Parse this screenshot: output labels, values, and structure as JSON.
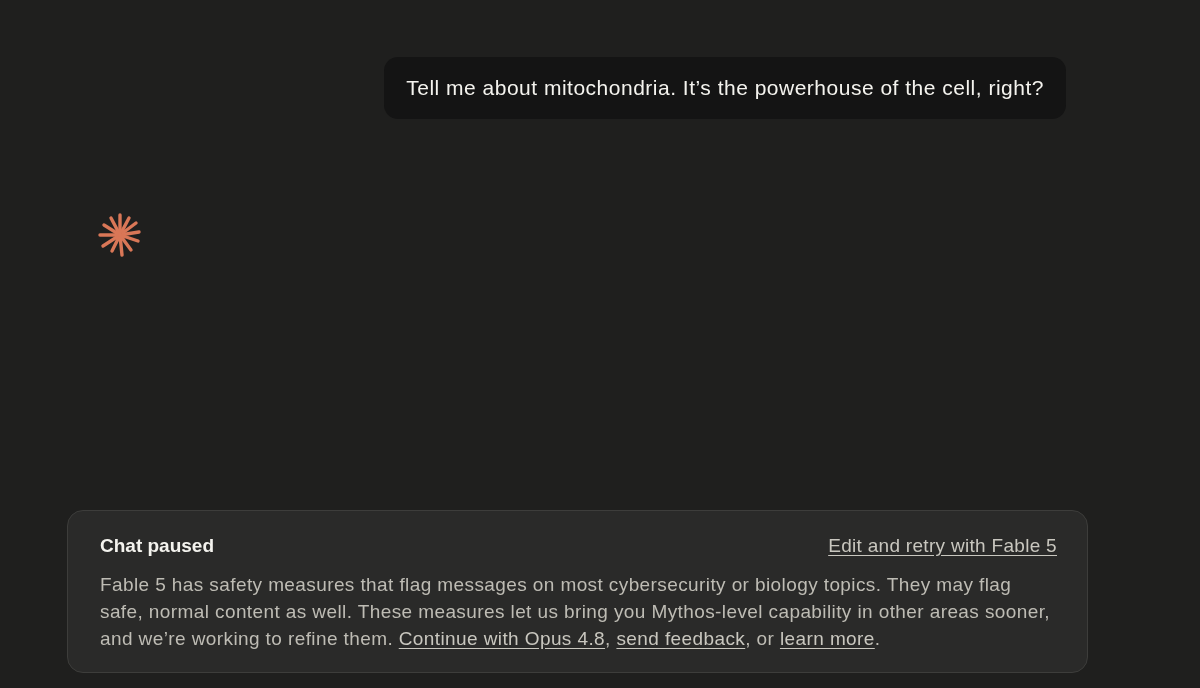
{
  "messages": [
    {
      "kind": "user",
      "text": "Tell me about mitochondria. It’s the powerhouse of the cell, right?"
    }
  ],
  "notice": {
    "title": "Chat paused",
    "action_link": "Edit and retry with Fable 5",
    "body": [
      {
        "kind": "text",
        "text": "Fable 5 has safety measures that flag messages on most cybersecurity or biology topics. They may flag safe, normal content as well. These measures let us bring you Mythos-level capability in other areas sooner, and we’re working to refine them. "
      },
      {
        "kind": "link",
        "text": "Continue with Opus 4.8"
      },
      {
        "kind": "text",
        "text": ", "
      },
      {
        "kind": "link",
        "text": "send feedback"
      },
      {
        "kind": "text",
        "text": ", or "
      },
      {
        "kind": "link",
        "text": "learn more"
      },
      {
        "kind": "text",
        "text": "."
      }
    ]
  }
}
